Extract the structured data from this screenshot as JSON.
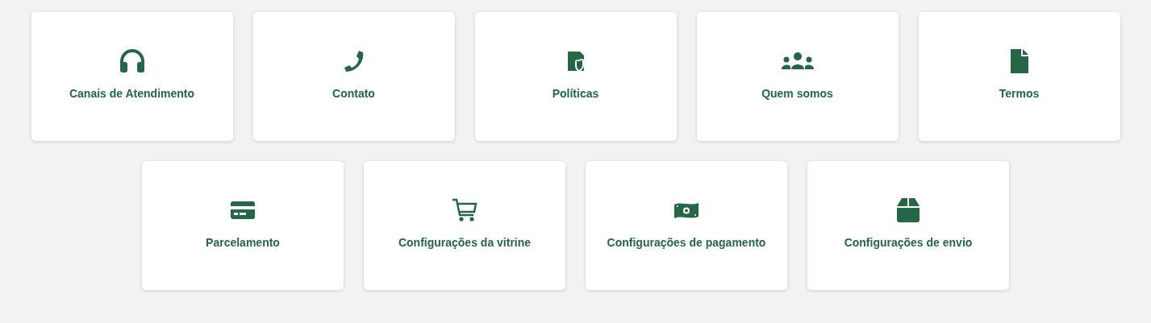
{
  "cards": [
    {
      "label": "Canais de Atendimento"
    },
    {
      "label": "Contato"
    },
    {
      "label": "Políticas"
    },
    {
      "label": "Quem somos"
    },
    {
      "label": "Termos"
    },
    {
      "label": "Parcelamento"
    },
    {
      "label": "Configurações da vitrine"
    },
    {
      "label": "Configurações de pagamento"
    },
    {
      "label": "Configurações de envio"
    }
  ]
}
